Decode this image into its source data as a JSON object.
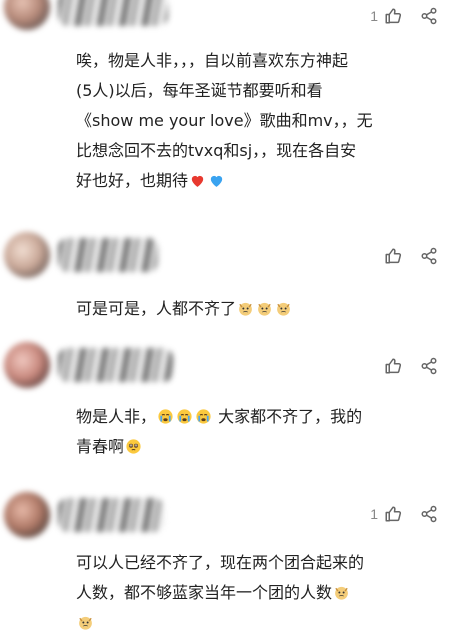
{
  "comments": [
    {
      "like_count": "1",
      "lines": [
        "唉，物是人非，，，自以前喜欢东方神起",
        "(5人)以后，每年圣诞节都要听和看",
        "《show me your love》歌曲和mv，，无",
        "比想念回不去的tvxq和sj，，现在各自安",
        "好也好，也期待"
      ],
      "emojis": [
        "red-heart",
        "blue-heart"
      ]
    },
    {
      "like_count": "",
      "text": "可是可是，人都不齐了",
      "emojis": [
        "crying-dog",
        "crying-dog",
        "crying-dog"
      ]
    },
    {
      "like_count": "",
      "line1": "物是人非，",
      "line1_emojis": [
        "crying-face",
        "crying-face",
        "crying-face"
      ],
      "line1_tail": "大家都不齐了，我的",
      "line2": "青春啊",
      "line2_emojis": [
        "pleading-face"
      ]
    },
    {
      "like_count": "1",
      "lines": [
        "可以人已经不齐了，现在两个团合起来的",
        "人数，都不够蓝家当年一个团的人数"
      ],
      "emojis": [
        "crying-dog",
        "crying-dog"
      ]
    }
  ],
  "icons": {
    "like": "thumbs-up-icon",
    "share": "share-icon"
  },
  "colors": {
    "icon": "#666666",
    "text": "#222222",
    "count": "#888888"
  }
}
